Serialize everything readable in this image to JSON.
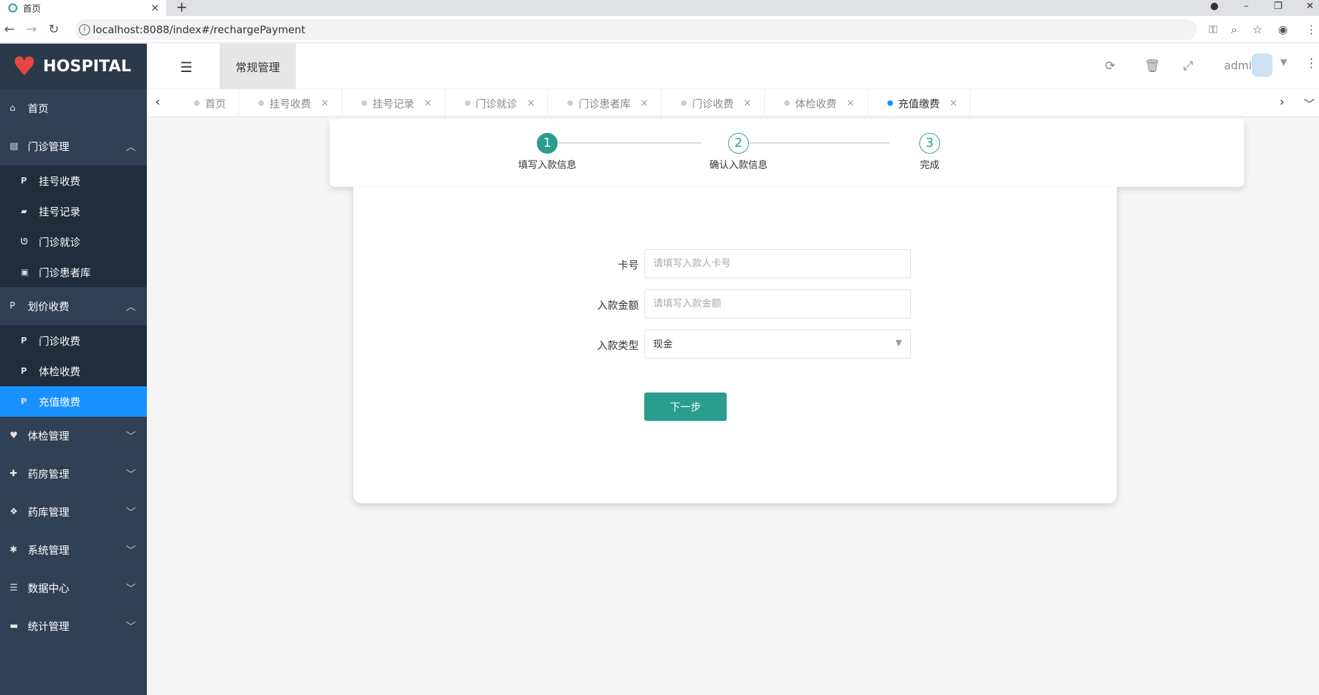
{
  "browser": {
    "tab_title": "首页",
    "tab_close": "×",
    "new_tab": "+",
    "url": "localhost:8088/index#/rechargePayment",
    "nav_back": "←",
    "nav_forward": "→",
    "nav_reload": "↻",
    "window_min": "–",
    "window_max": "❐",
    "window_close": "✕"
  },
  "sidebar": {
    "logo": "HOSPITAL",
    "items": [
      {
        "label": "首页",
        "icon": "home-icon"
      },
      {
        "label": "门诊管理",
        "icon": "clipboard-icon",
        "expanded": true,
        "children": [
          {
            "label": "挂号收费",
            "icon": "paypal-icon"
          },
          {
            "label": "挂号记录",
            "icon": "book-icon"
          },
          {
            "label": "门诊就诊",
            "icon": "stethoscope-icon"
          },
          {
            "label": "门诊患者库",
            "icon": "id-card-icon"
          }
        ]
      },
      {
        "label": "划价收费",
        "icon": "paypal-icon",
        "expanded": true,
        "children": [
          {
            "label": "门诊收费",
            "icon": "paypal-icon"
          },
          {
            "label": "体检收费",
            "icon": "paypal-icon"
          },
          {
            "label": "充值缴费",
            "icon": "paypal-icon",
            "active": true
          }
        ]
      },
      {
        "label": "体检管理",
        "icon": "heartbeat-icon"
      },
      {
        "label": "药房管理",
        "icon": "medkit-icon"
      },
      {
        "label": "药库管理",
        "icon": "cubes-icon"
      },
      {
        "label": "系统管理",
        "icon": "gear-icon"
      },
      {
        "label": "数据中心",
        "icon": "database-icon"
      },
      {
        "label": "统计管理",
        "icon": "comment-icon"
      }
    ]
  },
  "header": {
    "menu_label": "常规管理",
    "user": "admin"
  },
  "tags": [
    {
      "label": "首页",
      "active": false,
      "closable": false
    },
    {
      "label": "挂号收费",
      "active": false,
      "closable": true
    },
    {
      "label": "挂号记录",
      "active": false,
      "closable": true
    },
    {
      "label": "门诊就诊",
      "active": false,
      "closable": true
    },
    {
      "label": "门诊患者库",
      "active": false,
      "closable": true
    },
    {
      "label": "门诊收费",
      "active": false,
      "closable": true
    },
    {
      "label": "体检收费",
      "active": false,
      "closable": true
    },
    {
      "label": "充值缴费",
      "active": true,
      "closable": true
    }
  ],
  "steps": [
    {
      "num": "1",
      "label": "填写入款信息",
      "done": true
    },
    {
      "num": "2",
      "label": "确认入款信息",
      "done": false
    },
    {
      "num": "3",
      "label": "完成",
      "done": false
    }
  ],
  "form": {
    "card_label": "卡号",
    "card_placeholder": "请填写入款人卡号",
    "amount_label": "入款金额",
    "amount_placeholder": "请填写入款金额",
    "type_label": "入款类型",
    "type_value": "现金",
    "next_button": "下一步"
  },
  "colors": {
    "accent": "#2a9d8f",
    "active_menu": "#1890ff",
    "sidebar": "#304156"
  }
}
